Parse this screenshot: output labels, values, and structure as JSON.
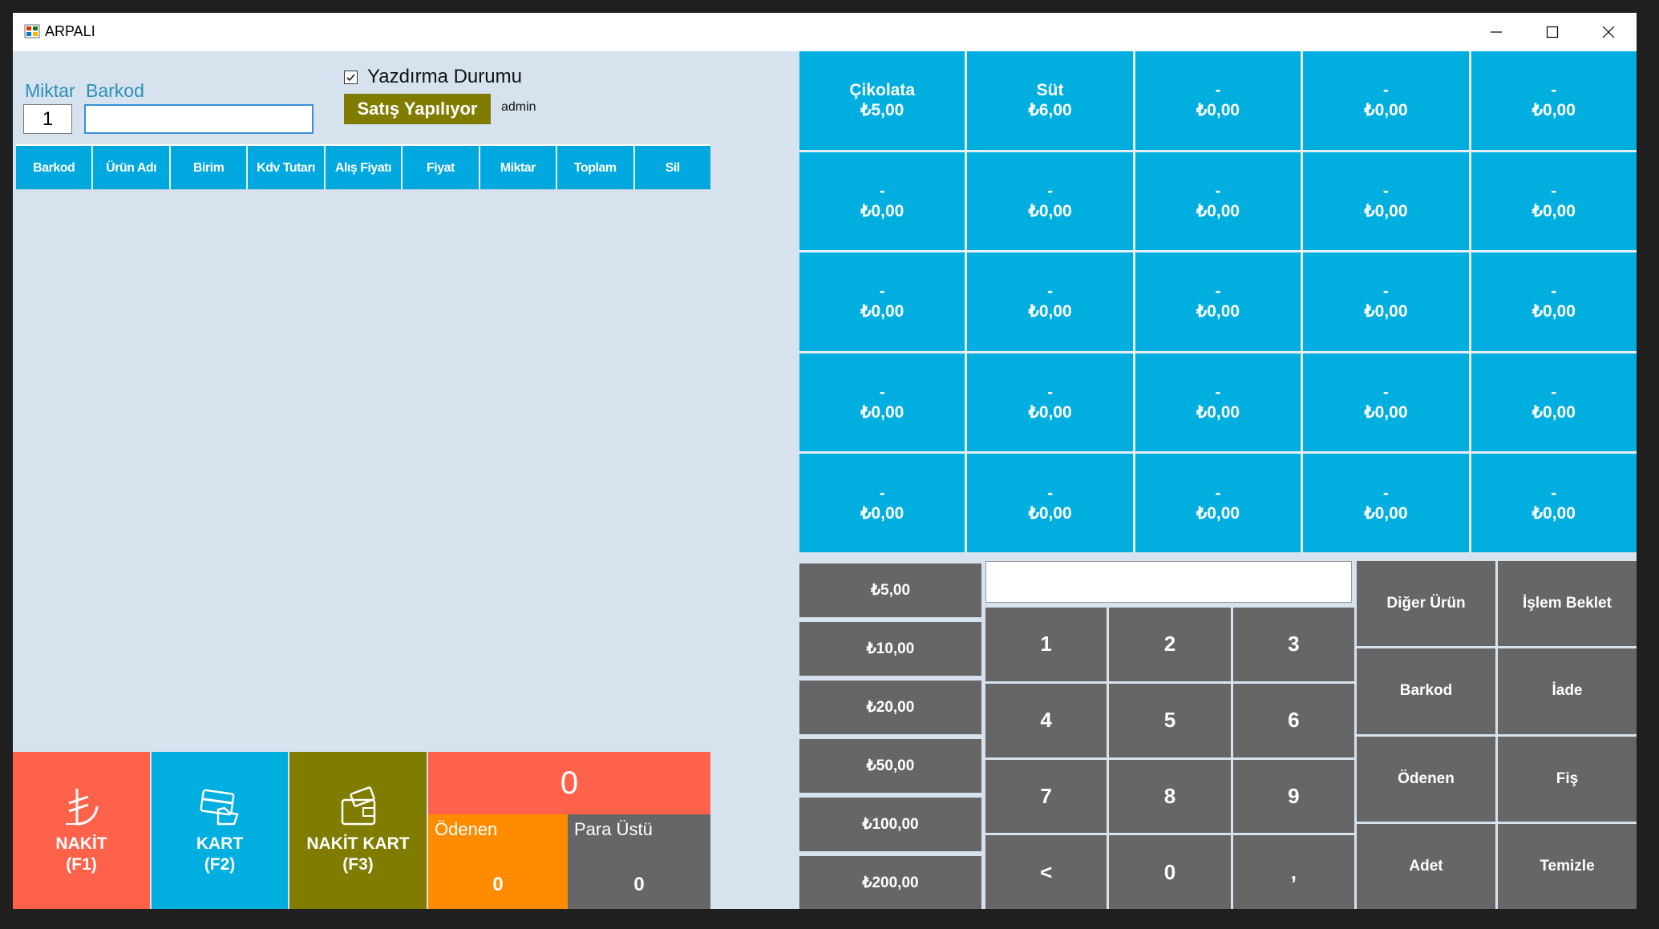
{
  "window": {
    "title": "ARPALI"
  },
  "sales_form": {
    "quantity_label": "Miktar",
    "barcode_label": "Barkod",
    "quantity_value": "1",
    "barcode_value": "",
    "print_status_label": "Yazdırma Durumu",
    "print_status_checked": true,
    "status_button": "Satış Yapılıyor",
    "user": "admin"
  },
  "cart_table": {
    "columns": [
      "Barkod",
      "Ürün Adı",
      "Birim",
      "Kdv Tutarı",
      "Alış Fiyatı",
      "Fiyat",
      "Miktar",
      "Toplam",
      "Sil"
    ],
    "rows": []
  },
  "quick_products": [
    {
      "name": "Çikolata",
      "price": "₺5,00"
    },
    {
      "name": "Süt",
      "price": "₺6,00"
    },
    {
      "name": "-",
      "price": "₺0,00"
    },
    {
      "name": "-",
      "price": "₺0,00"
    },
    {
      "name": "-",
      "price": "₺0,00"
    },
    {
      "name": "-",
      "price": "₺0,00"
    },
    {
      "name": "-",
      "price": "₺0,00"
    },
    {
      "name": "-",
      "price": "₺0,00"
    },
    {
      "name": "-",
      "price": "₺0,00"
    },
    {
      "name": "-",
      "price": "₺0,00"
    },
    {
      "name": "-",
      "price": "₺0,00"
    },
    {
      "name": "-",
      "price": "₺0,00"
    },
    {
      "name": "-",
      "price": "₺0,00"
    },
    {
      "name": "-",
      "price": "₺0,00"
    },
    {
      "name": "-",
      "price": "₺0,00"
    },
    {
      "name": "-",
      "price": "₺0,00"
    },
    {
      "name": "-",
      "price": "₺0,00"
    },
    {
      "name": "-",
      "price": "₺0,00"
    },
    {
      "name": "-",
      "price": "₺0,00"
    },
    {
      "name": "-",
      "price": "₺0,00"
    },
    {
      "name": "-",
      "price": "₺0,00"
    },
    {
      "name": "-",
      "price": "₺0,00"
    },
    {
      "name": "-",
      "price": "₺0,00"
    },
    {
      "name": "-",
      "price": "₺0,00"
    },
    {
      "name": "-",
      "price": "₺0,00"
    }
  ],
  "money_buttons": [
    "₺5,00",
    "₺10,00",
    "₺20,00",
    "₺50,00",
    "₺100,00",
    "₺200,00"
  ],
  "calculator": {
    "display": "",
    "keys": [
      "1",
      "2",
      "3",
      "4",
      "5",
      "6",
      "7",
      "8",
      "9",
      "<",
      "0",
      ","
    ]
  },
  "function_buttons": [
    "Diğer Ürün",
    "İşlem Beklet",
    "Barkod",
    "İade",
    "Ödenen",
    "Fiş",
    "Adet",
    "Temizle"
  ],
  "payment": {
    "cash": {
      "label": "NAKİT",
      "shortcut": "(F1)"
    },
    "card": {
      "label": "KART",
      "shortcut": "(F2)"
    },
    "cash_card": {
      "label": "NAKİT KART",
      "shortcut": "(F3)"
    },
    "total": "0",
    "paid_label": "Ödenen",
    "paid_value": "0",
    "change_label": "Para Üstü",
    "change_value": "0"
  },
  "colors": {
    "accent_blue": "#00aee0",
    "button_gray": "#666666",
    "cash_red": "#ff624a",
    "olive": "#807c00",
    "paid_orange": "#ff8c00",
    "background": "#d6e2ee"
  }
}
